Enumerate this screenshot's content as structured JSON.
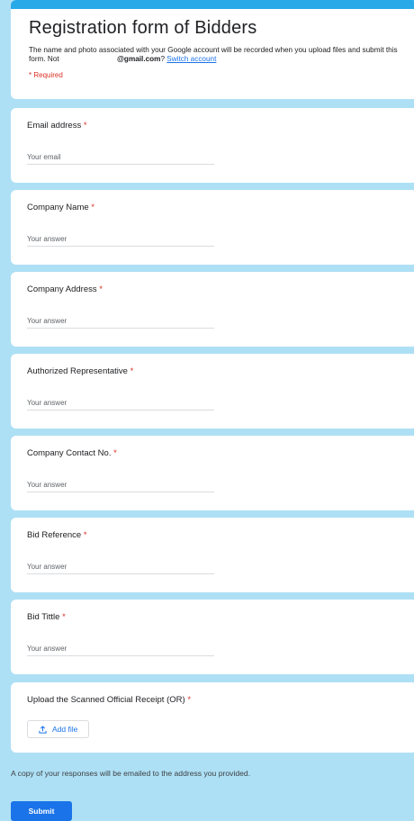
{
  "form": {
    "title": "Registration form of Bidders",
    "description_prefix": "The name and photo associated with your Google account will be recorded when you upload files and submit this form. Not",
    "email_domain": "@gmail.com",
    "question_mark": "?",
    "switch_account": "Switch account",
    "required_note": "* Required"
  },
  "questions": [
    {
      "label": "Email address",
      "placeholder": "Your email"
    },
    {
      "label": "Company Name",
      "placeholder": "Your answer"
    },
    {
      "label": "Company Address",
      "placeholder": "Your answer"
    },
    {
      "label": "Authorized Representative",
      "placeholder": "Your answer"
    },
    {
      "label": "Company Contact No.",
      "placeholder": "Your answer"
    },
    {
      "label": "Bid Reference",
      "placeholder": "Your answer"
    },
    {
      "label": "Bid Tittle",
      "placeholder": "Your answer"
    }
  ],
  "upload": {
    "label": "Upload the Scanned Official Receipt (OR)",
    "button_label": "Add file"
  },
  "required_star": "*",
  "footer": {
    "copy_note": "A copy of your responses will be emailed to the address you provided.",
    "submit_label": "Submit"
  },
  "colors": {
    "accent": "#29a9e8",
    "background": "#aee0f5",
    "link": "#1a73e8",
    "required": "#d93025"
  }
}
